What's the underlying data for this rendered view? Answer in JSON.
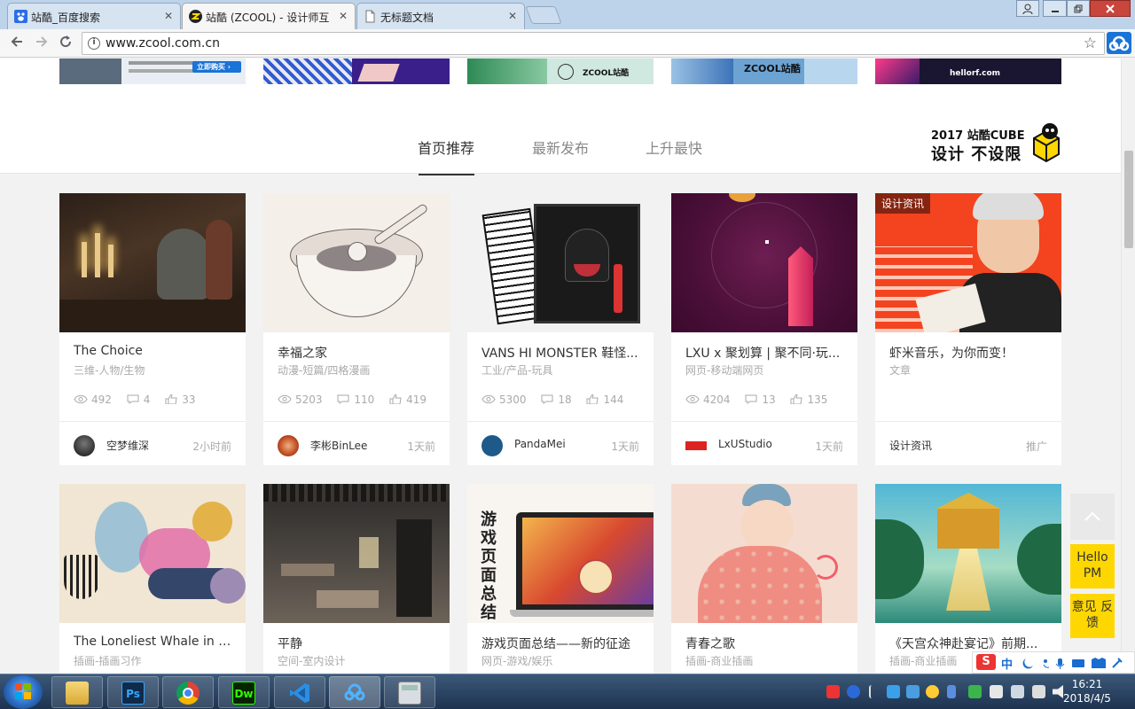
{
  "browser": {
    "tabs": [
      {
        "title": "站酷_百度搜索",
        "active": false
      },
      {
        "title": "站酷 (ZCOOL) - 设计师互",
        "active": true
      },
      {
        "title": "无标题文档",
        "active": false
      }
    ],
    "url": "www.zcool.com.cn",
    "close_glyph": "✕"
  },
  "banners": [
    {
      "text": "立即购买 ›"
    },
    {
      "text": ""
    },
    {
      "text": "ZCOOL站酷"
    },
    {
      "text": "ZCOOL站酷"
    },
    {
      "text": "hellorf.com"
    }
  ],
  "nav": {
    "tabs": [
      {
        "label": "首页推荐",
        "active": true
      },
      {
        "label": "最新发布",
        "active": false
      },
      {
        "label": "上升最快",
        "active": false
      }
    ]
  },
  "cube_logo": {
    "line1": "2017 站酷CUBE",
    "line2": "设计 不设限"
  },
  "cards_row1": [
    {
      "title": "The Choice",
      "category": "三维-人物/生物",
      "views": "492",
      "comments": "4",
      "likes": "33",
      "author": "空梦维深",
      "time": "2小时前"
    },
    {
      "title": "幸福之家",
      "category": "动漫-短篇/四格漫画",
      "views": "5203",
      "comments": "110",
      "likes": "419",
      "author": "李彬BinLee",
      "time": "1天前"
    },
    {
      "title": "VANS HI MONSTER 鞋怪...",
      "category": "工业/产品-玩具",
      "views": "5300",
      "comments": "18",
      "likes": "144",
      "author": "PandaMei",
      "time": "1天前"
    },
    {
      "title": "LXU x 聚划算 | 聚不同·玩...",
      "category": "网页-移动端网页",
      "views": "4204",
      "comments": "13",
      "likes": "135",
      "author": "LxUStudio",
      "time": "1天前"
    },
    {
      "title": "虾米音乐，为你而变！",
      "category": "文章",
      "badge": "设计资讯",
      "author": "设计资讯",
      "time": "推广"
    }
  ],
  "cards_row2": [
    {
      "title": "The Loneliest Whale in t...",
      "category": "插画-插画习作"
    },
    {
      "title": "平静",
      "category": "空间-室内设计"
    },
    {
      "title": "游戏页面总结——新的征途",
      "category": "网页-游戏/娱乐"
    },
    {
      "title": "青春之歌",
      "category": "插画-商业插画"
    },
    {
      "title": "《天宫众神赴宴记》前期...",
      "category": "插画-商业插画"
    }
  ],
  "float_buttons": {
    "top": "︿",
    "hello": "Hello PM",
    "feedback": "意见 反馈"
  },
  "ime": {
    "s": "S",
    "mode": "中"
  },
  "taskbar": {
    "apps": [
      {
        "name": "explorer",
        "label": ""
      },
      {
        "name": "photoshop",
        "label": "Ps"
      },
      {
        "name": "chrome",
        "label": ""
      },
      {
        "name": "dreamweaver",
        "label": "Dw"
      },
      {
        "name": "vscode",
        "label": ""
      },
      {
        "name": "baidu-netdisk",
        "label": ""
      },
      {
        "name": "calculator",
        "label": ""
      }
    ],
    "time": "16:21",
    "date": "2018/4/5"
  },
  "colors": {
    "accent_yellow": "#ffd700",
    "chrome_blue": "#bcd3ea"
  }
}
